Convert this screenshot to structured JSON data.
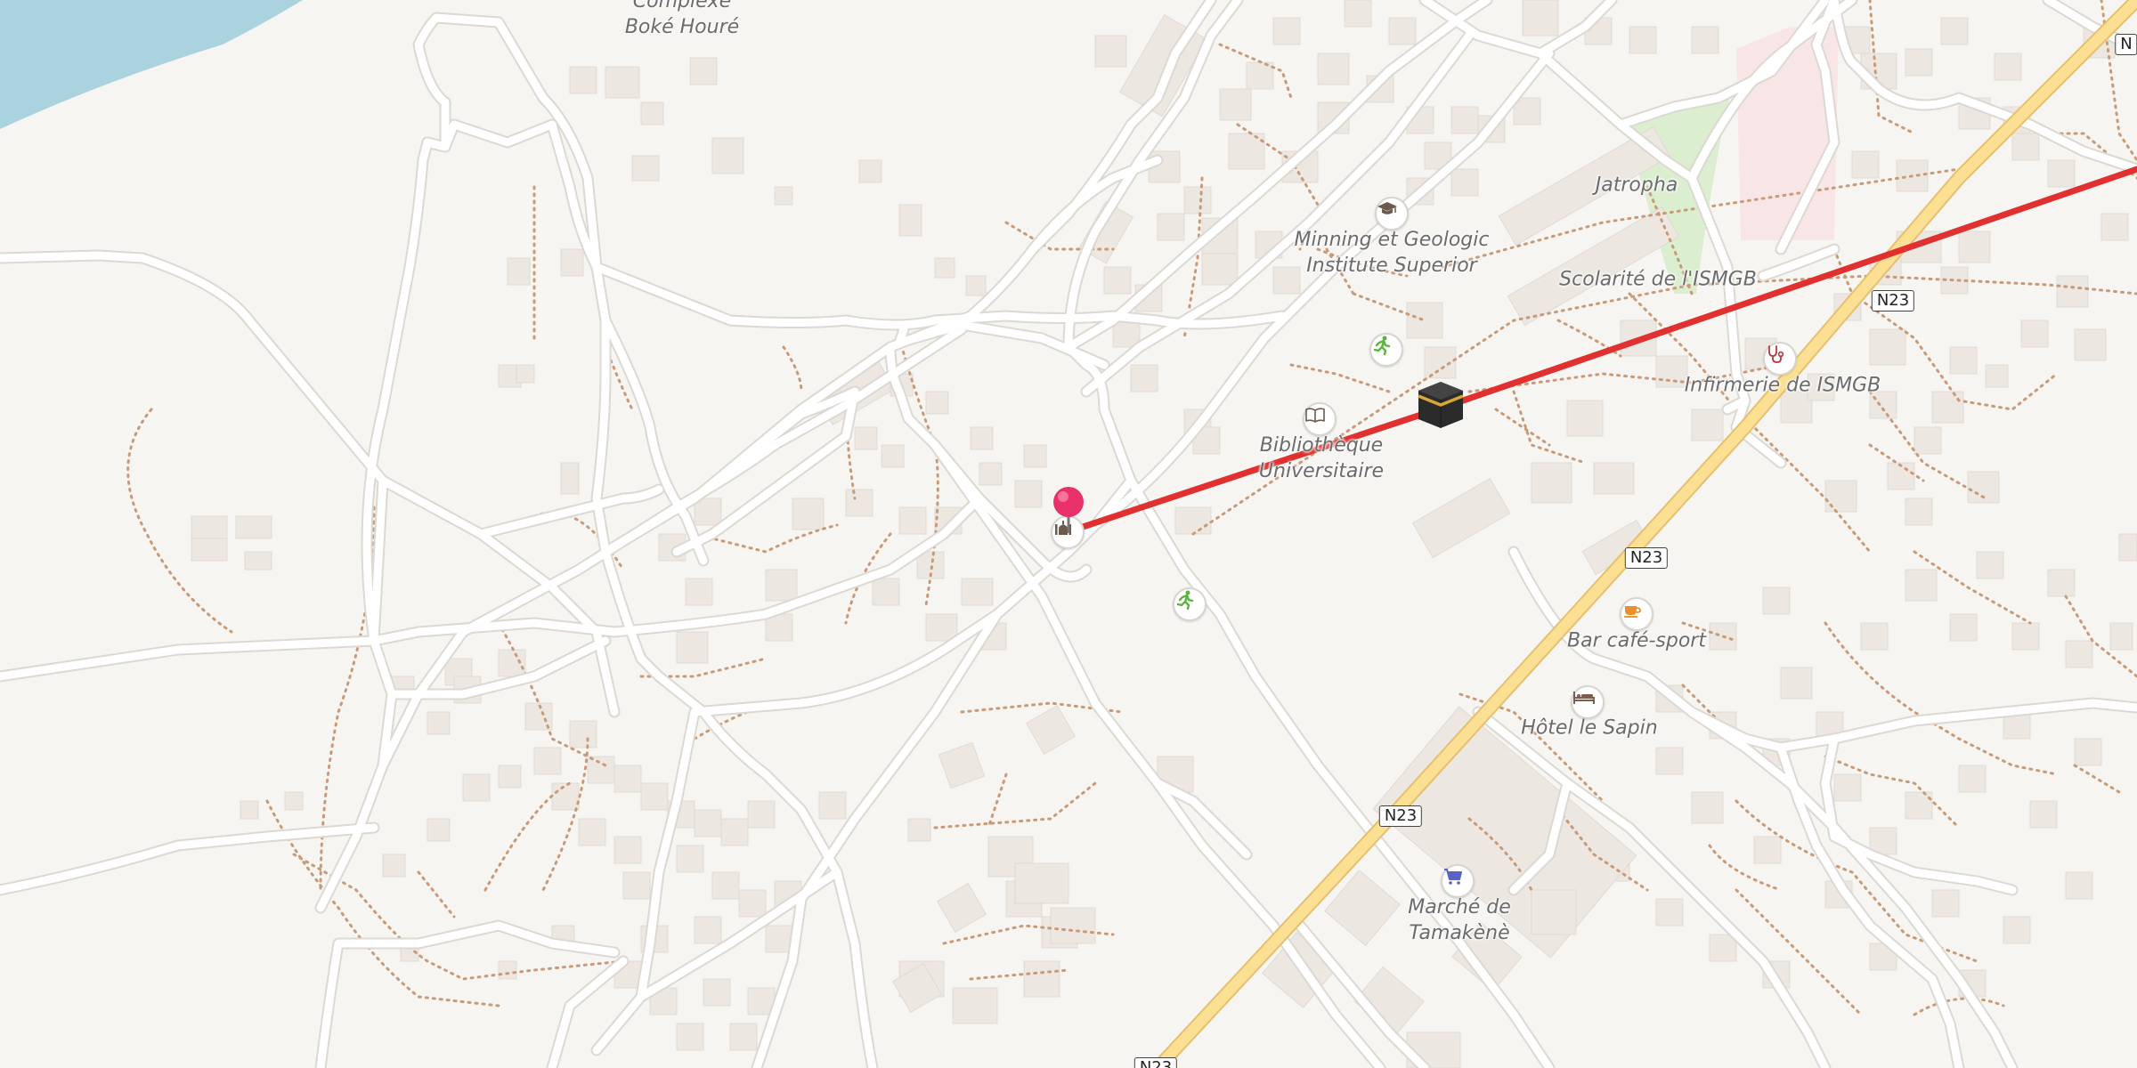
{
  "labels": {
    "complexe": [
      "Complexe",
      "Boké Houré"
    ],
    "minning": [
      "Minning et Geologic",
      "Institute Superior"
    ],
    "jatropha": "Jatropha",
    "scolarite": "Scolarité de l'ISMGB",
    "infirmerie": "Infirmerie de ISMGB",
    "bibliotheque": [
      "Bibliothèque",
      "Universitaire"
    ],
    "bar": "Bar café-sport",
    "hotel": "Hôtel le Sapin",
    "marche": [
      "Marché de",
      "Tamakènè"
    ]
  },
  "road_shields": [
    "N23",
    "N23",
    "N23",
    "N23",
    "N"
  ],
  "icons": {
    "school": "graduation-cap-icon",
    "sport": "running-person-icon",
    "library": "open-book-icon",
    "worship": "kaaba-icon",
    "hospital": "stethoscope-icon",
    "cafe": "coffee-cup-icon",
    "hotel": "bed-icon",
    "shop": "shopping-cart-icon",
    "museum": "mosque-icon",
    "pin": "map-pin-icon"
  },
  "colors": {
    "background": "#f7f5f2",
    "water": "#aad3df",
    "road": "#ffffff",
    "road_outline": "#dcd8d2",
    "primary_road": "#fbdf92",
    "building": "#ece7e1",
    "path": "#c99a78",
    "park": "#dbeed0",
    "hospital_area": "#f8e6e6",
    "route_line": "#e03030",
    "pin": "#e8316a",
    "label": "#6b6b6b"
  }
}
